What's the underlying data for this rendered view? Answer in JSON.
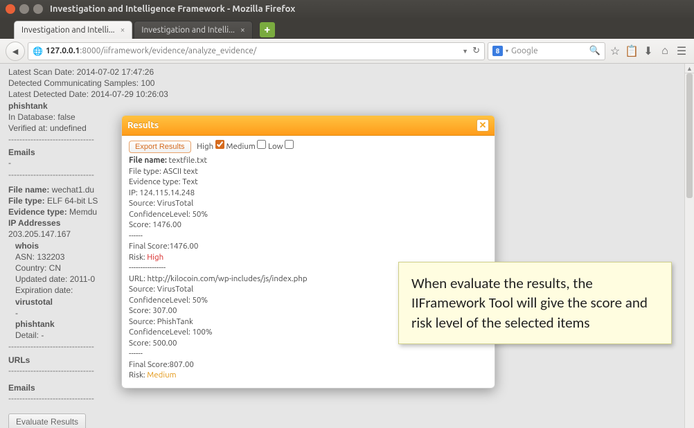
{
  "window": {
    "title": "Investigation and Intelligence Framework - Mozilla Firefox"
  },
  "tabs": [
    {
      "label": "Investigation and Intelli..."
    },
    {
      "label": "Investigation and Intelli..."
    }
  ],
  "url": {
    "host": "127.0.0.1",
    "port_path": ":8000/iiframework/evidence/analyze_evidence/"
  },
  "search": {
    "provider": "8",
    "placeholder": "Google"
  },
  "page": {
    "scan_header": "Latest Scan Date: 2014-07-02 17:47:26",
    "detected_comm": "Detected Communicating Samples: 100",
    "latest_detected": "Latest Detected Date: 2014-07-29 10:26:03",
    "phishtank_label": "phishtank",
    "in_db": "In Database: false",
    "verified": "Verified at: undefined",
    "emails_head": "Emails",
    "dash": "-",
    "file_name_label": "File name:",
    "file_name_value": "wechat1.du",
    "file_type_label": "File type:",
    "file_type_value": "ELF 64-bit LS",
    "evidence_type_label": "Evidence type:",
    "evidence_type_value": "Memdu",
    "ip_head": "IP Addresses",
    "ip_value": "203.205.147.167",
    "whois_label": "whois",
    "asn": "ASN: 132203",
    "country": "Country: CN",
    "updated": "Updated date: 2011-0",
    "expiration": "Expiration date:",
    "virustotal_label": "virustotal",
    "phishtank2_label": "phishtank",
    "detail": "Detail: -",
    "urls_head": "URLs",
    "emails2_head": "Emails",
    "evaluate_button": "Evaluate Results"
  },
  "modal": {
    "title": "Results",
    "export": "Export Results",
    "high_label": "High",
    "medium_label": "Medium",
    "low_label": "Low",
    "lines": {
      "fn_label": "File name:",
      "fn_value": "textfile.txt",
      "ft": "File type: ASCII text",
      "et": "Evidence type: Text",
      "ip": "IP: 124.115.14.248",
      "src1": "Source: VirusTotal",
      "conf1": "ConfidenceLevel: 50%",
      "score1": "Score: 1476.00",
      "sep1": "------",
      "final1": "Final Score:1476.00",
      "risk1_label": "Risk:",
      "risk1_value": "High",
      "sep2": "----------------",
      "url": "URL: http://kilocoin.com/wp-includes/js/index.php",
      "src2": "Source: VirusTotal",
      "conf2": "ConfidenceLevel: 50%",
      "score2": "Score: 307.00",
      "src3": "Source: PhishTank",
      "conf3": "ConfidenceLevel: 100%",
      "score3": "Score: 500.00",
      "sep3": "------",
      "final2": "Final Score:807.00",
      "risk2_label": "Risk:",
      "risk2_value": "Medium"
    }
  },
  "callout": {
    "text": "When evaluate the results, the IIFramework Tool will give the score and risk level of the selected items"
  }
}
